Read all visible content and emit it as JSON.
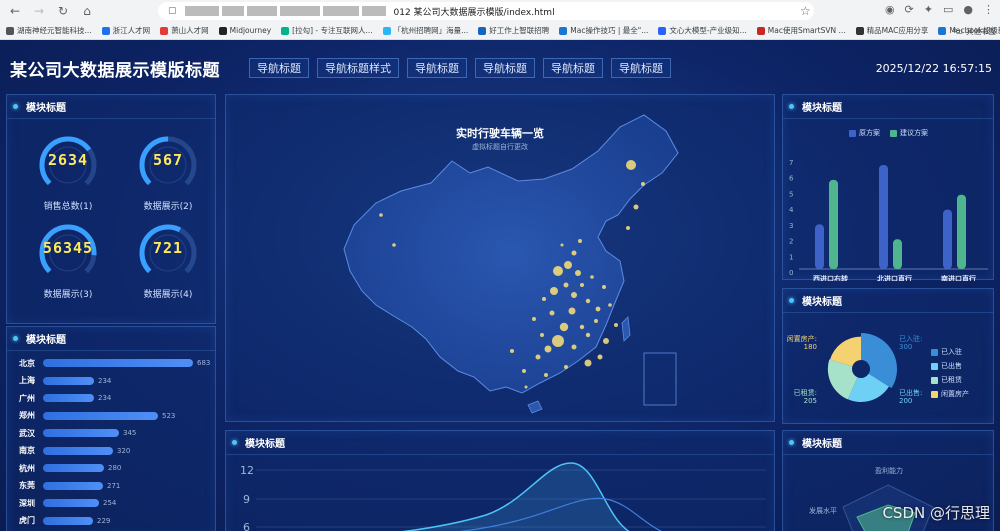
{
  "browser": {
    "address_text": "012 某公司大数据展示模版/index.html",
    "bookmarks": [
      {
        "label": "湖南神经元智能科技...",
        "color": "#555"
      },
      {
        "label": "浙江人才网",
        "color": "#1a73e8"
      },
      {
        "label": "萧山人才网",
        "color": "#e53935"
      },
      {
        "label": "Midjourney",
        "color": "#222"
      },
      {
        "label": "[拉勾] - 专注互联网人...",
        "color": "#00b38a"
      },
      {
        "label": "「杭州招聘网」海量...",
        "color": "#29b6f6"
      },
      {
        "label": "好工作上智联招聘",
        "color": "#1565c0"
      },
      {
        "label": "Mac操作技巧 | 最全\"...",
        "color": "#1976d2"
      },
      {
        "label": "文心大模型-产业级知...",
        "color": "#2962ff"
      },
      {
        "label": "Mac使用SmartSVN ...",
        "color": "#c62828"
      },
      {
        "label": "精品MAC应用分享",
        "color": "#333"
      },
      {
        "label": "Macbook超级新手使...",
        "color": "#1976d2"
      }
    ],
    "more_label": "»",
    "other_bookmarks": "其他书签"
  },
  "header": {
    "title": "某公司大数据展示模版标题",
    "nav": [
      "导航标题",
      "导航标题样式",
      "导航标题",
      "导航标题",
      "导航标题",
      "导航标题"
    ],
    "datetime": "2025/12/22 16:57:15"
  },
  "panels": {
    "gauges_title": "模块标题",
    "rank_title": "模块标题",
    "bar_title": "模块标题",
    "pie_title": "模块标题",
    "line_title": "模块标题",
    "radar_title": "模块标题"
  },
  "gauges": [
    {
      "value": "2634",
      "label": "销售总数(1)",
      "level": 0.7
    },
    {
      "value": "567",
      "label": "数据展示(2)",
      "level": 0.5
    },
    {
      "value": "56345",
      "label": "数据展示(3)",
      "level": 0.85
    },
    {
      "value": "721",
      "label": "数据展示(4)",
      "level": 0.6
    }
  ],
  "ranking": [
    {
      "city": "北京",
      "value": "683",
      "n": 683
    },
    {
      "city": "上海",
      "value": "234",
      "n": 234
    },
    {
      "city": "广州",
      "value": "234",
      "n": 234
    },
    {
      "city": "郑州",
      "value": "523",
      "n": 523
    },
    {
      "city": "武汉",
      "value": "345",
      "n": 345
    },
    {
      "city": "南京",
      "value": "320",
      "n": 320
    },
    {
      "city": "杭州",
      "value": "280",
      "n": 280
    },
    {
      "city": "东莞",
      "value": "271",
      "n": 271
    },
    {
      "city": "深圳",
      "value": "254",
      "n": 254
    },
    {
      "city": "虎门",
      "value": "229",
      "n": 229
    }
  ],
  "map": {
    "title": "实时行驶车辆一览",
    "subtitle": "虚拟标题自行更改"
  },
  "bar_chart": {
    "legend": [
      "原方案",
      "建议方案"
    ],
    "colors": [
      "#3d63c9",
      "#4fb58f"
    ],
    "categories": [
      "西进口右转",
      "北进口直行",
      "南进口直行"
    ],
    "series": [
      [
        3,
        7,
        4
      ],
      [
        6,
        2,
        5
      ]
    ],
    "ymax": 7,
    "yticks": [
      "7",
      "6",
      "5",
      "4",
      "3",
      "2",
      "1",
      "0"
    ]
  },
  "pie_chart": {
    "legend": [
      "已入驻",
      "已出售",
      "已租赁",
      "闲置房产"
    ],
    "colors": [
      "#3a8ed8",
      "#6fd0f5",
      "#a6e2c9",
      "#f5d271"
    ],
    "values": [
      300,
      200,
      205,
      180
    ],
    "labels": [
      "已入驻:\n300",
      "已出售:\n200",
      "已租赁:\n205",
      "闲置房产:\n180"
    ]
  },
  "line_chart": {
    "yticks": [
      "12",
      "9",
      "6"
    ]
  },
  "radar": {
    "labels": [
      "盈利能力",
      "发展水平"
    ]
  },
  "watermark": "CSDN @行思理"
}
